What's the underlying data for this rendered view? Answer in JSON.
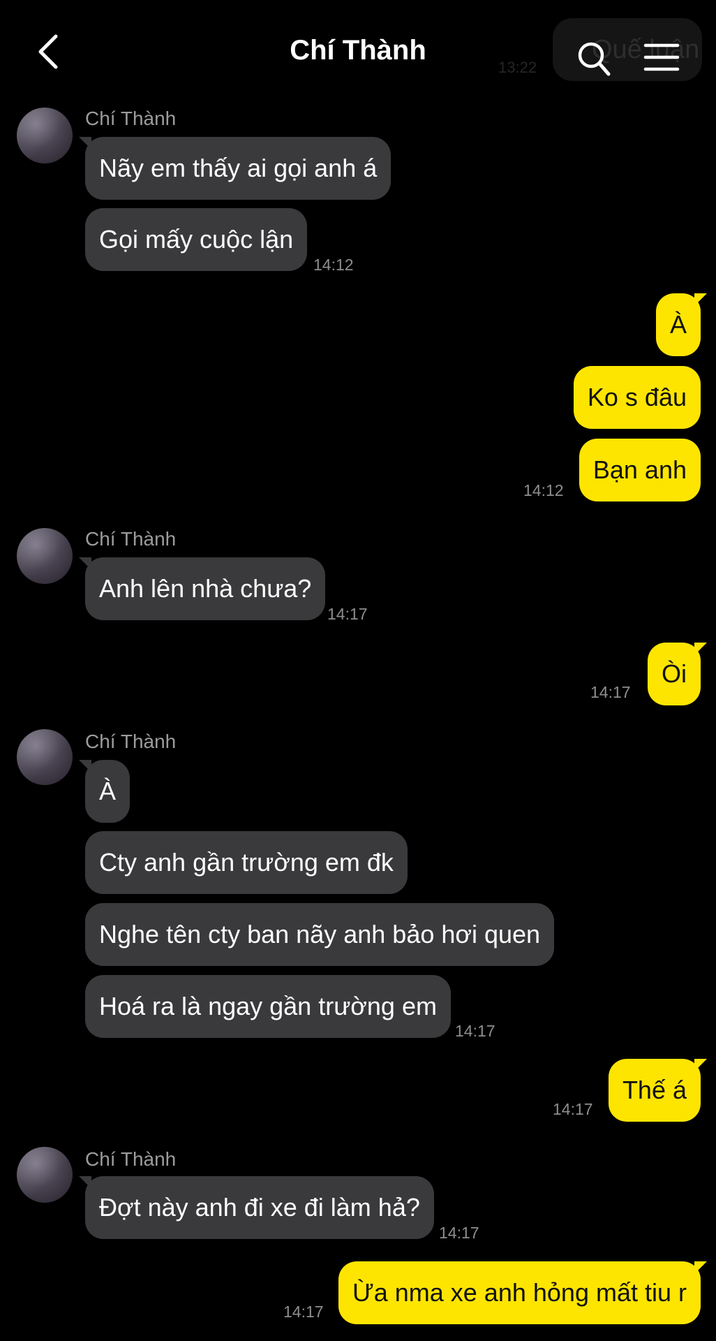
{
  "header": {
    "title": "Chí Thành",
    "ghost_text": "Quế luận",
    "ghost_time": "13:22"
  },
  "colors": {
    "background": "#000000",
    "incoming": "#3a3a3c",
    "outgoing": "#fee500"
  },
  "icons": {
    "back": "chevron-left-icon",
    "search": "search-icon",
    "menu": "menu-icon"
  },
  "messages": [
    {
      "sender": "Chí Thành"
    },
    {
      "text": "Nãy em thấy ai gọi anh á"
    },
    {
      "text": "Gọi mấy cuộc lận",
      "time": "14:12"
    },
    {
      "text": "À"
    },
    {
      "text": "Ko s đâu"
    },
    {
      "text": "Bạn anh",
      "time": "14:12"
    },
    {
      "sender": "Chí Thành"
    },
    {
      "text": "Anh lên nhà chưa?",
      "time": "14:17"
    },
    {
      "text": "Òi",
      "time": "14:17"
    },
    {
      "sender": "Chí Thành"
    },
    {
      "text": "À"
    },
    {
      "text": "Cty anh gần trường em đk"
    },
    {
      "text": "Nghe tên cty ban nãy anh bảo hơi quen"
    },
    {
      "text": "Hoá ra là ngay gần trường em",
      "time": "14:17"
    },
    {
      "text": "Thế á",
      "time": "14:17"
    },
    {
      "sender": "Chí Thành"
    },
    {
      "text": "Đợt này anh đi xe đi làm hả?",
      "time": "14:17"
    },
    {
      "text": "Ừa nma xe anh hỏng mất tiu r",
      "time": "14:17"
    }
  ]
}
